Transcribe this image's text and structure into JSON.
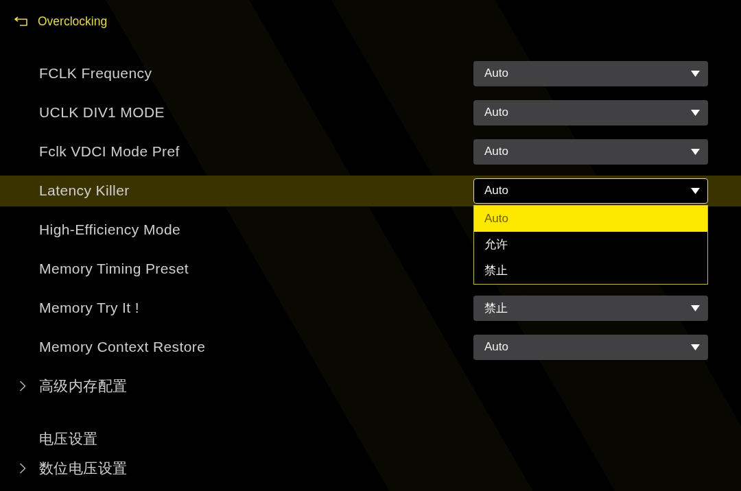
{
  "header": {
    "title": "Overclocking"
  },
  "settings": [
    {
      "kind": "option",
      "label": "FCLK Frequency",
      "value": "Auto",
      "expanded": false,
      "selected": false
    },
    {
      "kind": "option",
      "label": "UCLK DIV1 MODE",
      "value": "Auto",
      "expanded": false,
      "selected": false
    },
    {
      "kind": "option",
      "label": "Fclk VDCI Mode Pref",
      "value": "Auto",
      "expanded": false,
      "selected": false
    },
    {
      "kind": "option",
      "label": "Latency Killer",
      "value": "Auto",
      "expanded": true,
      "selected": true,
      "options": [
        {
          "label": "Auto",
          "selected": true
        },
        {
          "label": "允许",
          "selected": false
        },
        {
          "label": "禁止",
          "selected": false
        }
      ]
    },
    {
      "kind": "option",
      "label": "High-Efficiency Mode",
      "selected": false
    },
    {
      "kind": "option",
      "label": "Memory Timing Preset",
      "selected": false
    },
    {
      "kind": "option",
      "label": "Memory Try It !",
      "value": "禁止",
      "expanded": false,
      "selected": false
    },
    {
      "kind": "option",
      "label": "Memory Context Restore",
      "value": "Auto",
      "expanded": false,
      "selected": false
    },
    {
      "kind": "submenu",
      "label": "高级内存配置",
      "selected": false
    },
    {
      "kind": "heading",
      "label": "电压设置"
    },
    {
      "kind": "submenu",
      "label": "数位电压设置",
      "selected": false
    }
  ]
}
